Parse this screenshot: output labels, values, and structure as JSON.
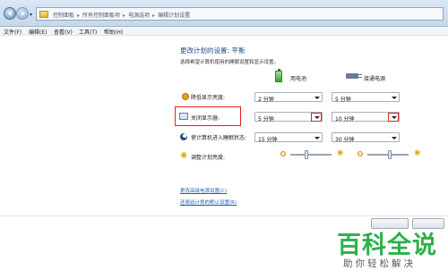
{
  "breadcrumb": {
    "items": [
      "控制面板",
      "所有控制面板项",
      "电源选项",
      "编辑计划设置"
    ],
    "separator": "▸"
  },
  "menubar": {
    "items": [
      "文件(F)",
      "编辑(E)",
      "查看(V)",
      "工具(T)",
      "帮助(H)"
    ]
  },
  "page": {
    "title": "更改计划的设置: 平衡",
    "subtitle": "选择希望计算机使用的睡眠设置和显示设置。"
  },
  "columns": {
    "battery": "用电池",
    "plugged": "接通电源"
  },
  "settings": [
    {
      "label": "降低显示亮度:",
      "battery": "2 分钟",
      "plugged": "5 分钟",
      "icon": "dim-display-icon"
    },
    {
      "label": "关闭显示器:",
      "battery": "5 分钟",
      "plugged": "10 分钟",
      "icon": "monitor-icon"
    },
    {
      "label": "使计算机进入睡眠状态:",
      "battery": "15 分钟",
      "plugged": "30 分钟",
      "icon": "sleep-moon-icon"
    }
  ],
  "brightness": {
    "label": "调整计划亮度:",
    "battery_level": 0.4,
    "plugged_level": 0.55
  },
  "links": {
    "advanced": "更改高级电源设置(C)",
    "restore": "还原此计划的默认设置(R)"
  },
  "watermark": {
    "title": "百科全说",
    "subtitle": "助你轻松解决"
  },
  "colors": {
    "highlight": "#e0201e",
    "link": "#1d5fb0",
    "title": "#1f4f86",
    "watermark": "#2db14c"
  }
}
